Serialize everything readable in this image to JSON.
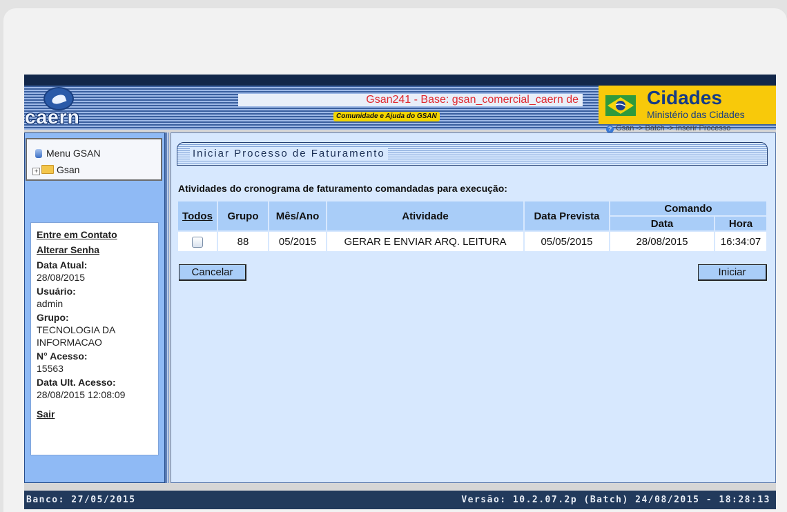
{
  "header": {
    "logo_text": "caern",
    "base_info": "Gsan241 - Base: gsan_comercial_caern de",
    "help_link": "Comunidade e Ajuda do GSAN",
    "gov_title": "Cidades",
    "gov_subtitle": "Ministério das Cidades",
    "breadcrumb": "Gsan -> Batch -> Inserir Processo"
  },
  "sidebar": {
    "menu_title": "Menu GSAN",
    "tree_root": "Gsan",
    "links": {
      "contact": "Entre em Contato",
      "password": "Alterar Senha",
      "logout": "Sair"
    },
    "info": [
      {
        "label": "Data Atual:",
        "value": "28/08/2015"
      },
      {
        "label": "Usuário:",
        "value": "admin"
      },
      {
        "label": "Grupo:",
        "value": "TECNOLOGIA DA INFORMACAO"
      },
      {
        "label": "N° Acesso:",
        "value": "15563"
      },
      {
        "label": "Data Ult. Acesso:",
        "value": "28/08/2015 12:08:09"
      }
    ]
  },
  "main": {
    "title": "Iniciar Processo de Faturamento",
    "subheading": "Atividades do cronograma de faturamento comandadas para execução:",
    "columns": {
      "todos": "Todos",
      "grupo": "Grupo",
      "mes_ano": "Mês/Ano",
      "atividade": "Atividade",
      "data_prevista": "Data Prevista",
      "comando": "Comando",
      "comando_data": "Data",
      "comando_hora": "Hora"
    },
    "rows": [
      {
        "checked": false,
        "grupo": "88",
        "mes_ano": "05/2015",
        "atividade": "GERAR E ENVIAR ARQ. LEITURA",
        "data_prevista": "05/05/2015",
        "comando_data": "28/08/2015",
        "comando_hora": "16:34:07"
      }
    ],
    "cancel_label": "Cancelar",
    "start_label": "Iniciar"
  },
  "footer": {
    "banco": "Banco: 27/05/2015",
    "versao": "Versão: 10.2.07.2p (Batch) 24/08/2015 - 18:28:13"
  },
  "colors": {
    "header_dark": "#12274a",
    "sidebar_bg": "#8fbaf5",
    "main_bg": "#d7e8fe",
    "table_header": "#a9cdf8",
    "base_text": "#e0282e",
    "gov_bg": "#f8c90a"
  },
  "icons": [
    "database-icon",
    "tree-expand-icon",
    "folder-icon",
    "help-icon",
    "brazil-flag-icon"
  ]
}
